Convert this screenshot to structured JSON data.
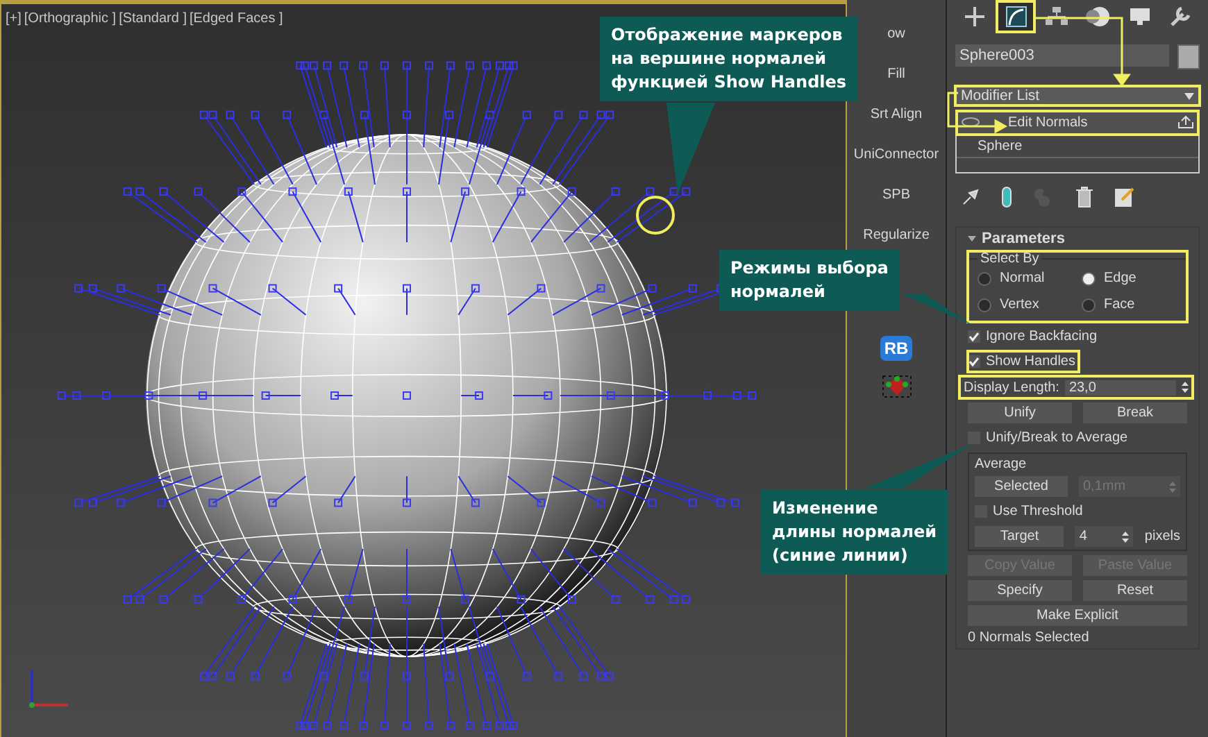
{
  "viewport": {
    "labels": [
      "[+]",
      "[Orthographic ]",
      "[Standard ]",
      "[Edged Faces ]"
    ]
  },
  "script_buttons": {
    "labels": [
      "ow",
      "Fill",
      "Srt Align",
      "UniConnector",
      "SPB",
      "Regularize"
    ],
    "rb_icon": "RB"
  },
  "command_panel": {
    "tabs": [
      {
        "kind": "create",
        "selected": false,
        "highlighted": false
      },
      {
        "kind": "modify",
        "selected": true,
        "highlighted": true
      },
      {
        "kind": "hierarchy",
        "selected": false,
        "highlighted": false
      },
      {
        "kind": "motion",
        "selected": false,
        "highlighted": false
      },
      {
        "kind": "display",
        "selected": false,
        "highlighted": false
      },
      {
        "kind": "utilities",
        "selected": false,
        "highlighted": false
      }
    ],
    "object_name": "Sphere003",
    "modifier_list": {
      "label": "Modifier List",
      "highlighted": true
    },
    "stack": [
      {
        "label": "Edit Normals",
        "selected": true,
        "highlighted": true
      },
      {
        "label": "Sphere",
        "selected": false,
        "highlighted": false
      }
    ]
  },
  "parameters": {
    "title": "Parameters",
    "select_by": {
      "title": "Select By",
      "highlighted": true,
      "options": [
        {
          "label": "Normal",
          "selected": false
        },
        {
          "label": "Edge",
          "selected": true
        },
        {
          "label": "Vertex",
          "selected": false
        },
        {
          "label": "Face",
          "selected": false
        }
      ]
    },
    "checkboxes": [
      {
        "label": "Ignore Backfacing",
        "checked": true,
        "highlighted": false
      },
      {
        "label": "Show Handles",
        "checked": true,
        "highlighted": true
      }
    ],
    "display_length": {
      "label": "Display Length:",
      "value": "23,0",
      "highlighted": true
    },
    "unify_row": [
      {
        "label": "Unify",
        "disabled": false
      },
      {
        "label": "Break",
        "disabled": false
      }
    ],
    "average_checkbox": {
      "label": "Unify/Break to Average",
      "checked": false
    },
    "average": {
      "title": "Average",
      "selected_button": "Selected",
      "threshold": {
        "value": "0,1mm",
        "disabled": true
      },
      "use_threshold": {
        "label": "Use Threshold",
        "checked": false
      },
      "target_button": "Target",
      "pixels": {
        "value": "4",
        "unit": "pixels"
      }
    },
    "copy_row": [
      {
        "label": "Copy Value",
        "disabled": true
      },
      {
        "label": "Paste Value",
        "disabled": true
      }
    ],
    "specify_row": [
      {
        "label": "Specify",
        "disabled": false
      },
      {
        "label": "Reset",
        "disabled": false
      }
    ],
    "make_explicit": "Make Explicit",
    "status": "0 Normals Selected"
  },
  "callouts": [
    {
      "text": "Отображение маркеров\nна вершине нормалей\nфункцией Show Handles"
    },
    {
      "text": "Режимы выбора\nнормалей"
    },
    {
      "text": "Изменение\nдлины нормалей\n(синие линии)"
    }
  ]
}
